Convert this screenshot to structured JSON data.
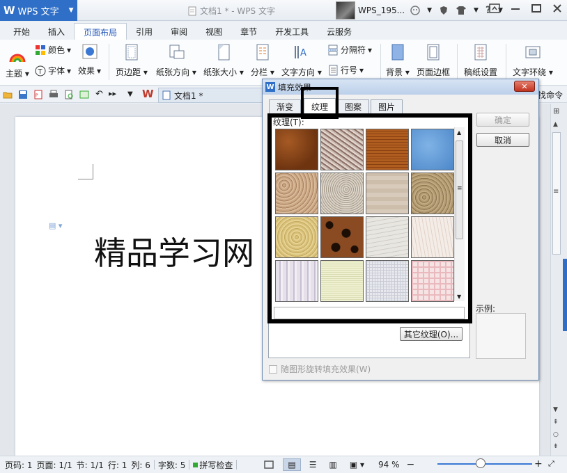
{
  "titlebar": {
    "app_logo": "W",
    "app_name": "WPS 文字",
    "doc_title": "文档1 * - WPS 文字",
    "username": "WPS_195...",
    "help": "?"
  },
  "tabs": [
    "开始",
    "插入",
    "页面布局",
    "引用",
    "审阅",
    "视图",
    "章节",
    "开发工具",
    "云服务"
  ],
  "ribbon": {
    "theme": "主题",
    "color": "颜色",
    "font": "字体",
    "effect": "效果",
    "margins": "页边距",
    "orientation": "纸张方向",
    "size": "纸张大小",
    "columns": "分栏",
    "text_direction": "文字方向",
    "breaks": "分隔符",
    "line_numbers": "行号",
    "background": "背景",
    "page_border": "页面边框",
    "draft_paper": "稿纸设置",
    "text_wrap": "文字环绕"
  },
  "doc_tab": "文档1 *",
  "cmd_hint": "找命令",
  "document": {
    "text": "精品学习网"
  },
  "dialog": {
    "title": "填充效果",
    "close": "✕",
    "tabs": [
      "渐变",
      "纹理",
      "图案",
      "图片"
    ],
    "active_tab": "纹理",
    "texture_label": "纹理(T):",
    "ok": "确定",
    "cancel": "取消",
    "other_textures": "其它纹理(O)...",
    "sample_label": "示例:",
    "rotate_checkbox": "随图形旋转填充效果(W)",
    "textures": [
      "brown-leather",
      "fossil",
      "woven-mat",
      "water-drops",
      "cork",
      "granite",
      "sand",
      "medium-wood",
      "canvas",
      "leopard",
      "newsprint",
      "white-marble",
      "stripes-blue",
      "green-paper",
      "denim-grid",
      "pink-tissue"
    ]
  },
  "statusbar": {
    "page": "页码: 1",
    "pages": "页面: 1/1",
    "section": "节: 1/1",
    "line": "行: 1",
    "column": "列: 6",
    "words": "字数: 5",
    "spell": "拼写检查",
    "zoom": "94 %",
    "zoom_level_percent": 94
  },
  "colors": {
    "accent": "#2f6fc7",
    "tab_active": "#2457b8",
    "close_red": "#c2321e"
  }
}
